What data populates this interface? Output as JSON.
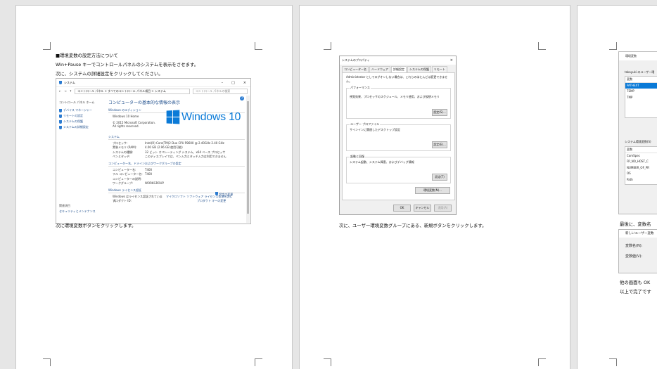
{
  "page1": {
    "heading": "■環境変数の設定方法について",
    "line1": "Win+Pause キーでコントロールパネルのシステムを表示をさせます。",
    "line2": "次に、システムの詳細設定をクリックしてください。",
    "after": "次に環境変数ボタンをクリックします。",
    "window": {
      "title": "システム",
      "breadcrumb": "コントロール パネル  >  すべてのコントロール パネル項目  >  システム",
      "search_placeholder": "コントロール パネルの検索",
      "sidebar_home": "コントロール パネル ホーム",
      "sidebar_items": [
        "デバイス マネージャー",
        "リモートの設定",
        "システムの保護",
        "システムの詳細設定"
      ],
      "sidebar_also": "関連項目",
      "sidebar_security": "セキュリティとメンテナンス",
      "main_title": "コンピューターの基本的な情報の表示",
      "edition_header": "Windows のエディション",
      "edition": "Windows 10 Home",
      "copyright": "© 2015 Microsoft Corporation. All rights reserved.",
      "logo_text": "Windows 10",
      "system_header": "システム",
      "system_rows": [
        {
          "k": "プロセッサ:",
          "v": "Intel(R) Core(TM)2 Duo CPU     P8600  @ 2.40GHz   2.40 GHz"
        },
        {
          "k": "実装メモリ (RAM):",
          "v": "4.00 GB (2.96 GB 使用可能)"
        },
        {
          "k": "システムの種類:",
          "v": "32 ビット オペレーティング システム、x64 ベース プロセッサ"
        },
        {
          "k": "ペンとタッチ:",
          "v": "このディスプレイでは、ペン入力とタッチ入力は利用できません"
        }
      ],
      "computer_header": "コンピューター名、ドメインおよびワークグループの設定",
      "computer_rows": [
        {
          "k": "コンピューター名:",
          "v": "T400"
        },
        {
          "k": "フル コンピューター名:",
          "v": "T400"
        },
        {
          "k": "コンピューターの説明:",
          "v": ""
        },
        {
          "k": "ワークグループ:",
          "v": "WORKGROUP"
        }
      ],
      "change_settings": "設定の変更",
      "license_header": "Windows ライセンス認証",
      "license_text": "Windows はライセンス認証されています。",
      "license_link": "マイクロソフト ソフトウェア ライセンス条項を読む",
      "product_id": "プロダクト ID: ",
      "product_key_link": "プロダクト キーの変更"
    }
  },
  "page2": {
    "after": "次に、ユーザー環境変数グループにある、新規ボタンをクリックします。",
    "dialog": {
      "title": "システムのプロパティ",
      "close": "×",
      "tabs": [
        "コンピューター名",
        "ハードウェア",
        "詳細設定",
        "システムの保護",
        "リモート"
      ],
      "admin_note": "Administrator としてログオンしない場合は、これらのほとんどは変更できません。",
      "perf_label": "パフォーマンス",
      "perf_text": "視覚効果、プロセッサのスケジュール、メモリ使用、および仮想メモリ",
      "profile_label": "ユーザー プロファイル",
      "profile_text": "サインインに関連したデスクトップ設定",
      "startup_label": "起動と回復",
      "startup_text": "システム起動、システム障害、およびデバッグ情報",
      "settings_btn_1": "設定(S)...",
      "settings_btn_2": "設定(E)...",
      "settings_btn_3": "設定(T)",
      "env_btn": "環境変数(N)...",
      "ok": "OK",
      "cancel": "キャンセル",
      "apply": "適用(A)"
    }
  },
  "page3": {
    "env_title": "環境変数",
    "user_vars_label": "takayuki のユーザー環",
    "var_header": "変数",
    "user_vars": [
      "PATHEXT",
      "TEMP",
      "TMP"
    ],
    "sys_vars_label": "システム環境変数(S)",
    "sys_vars": [
      "ComSpec",
      "FP_NO_HOST_C",
      "NUMBER_OF_PR",
      "OS",
      "Path"
    ],
    "final_text": "最後に、変数名",
    "new_var_title": "新しいユーザー変数",
    "var_name_label": "変数名(N):",
    "var_value_label": "変数値(V):",
    "other_text": "他の画面も OK",
    "done_text": "以上で完了です"
  }
}
